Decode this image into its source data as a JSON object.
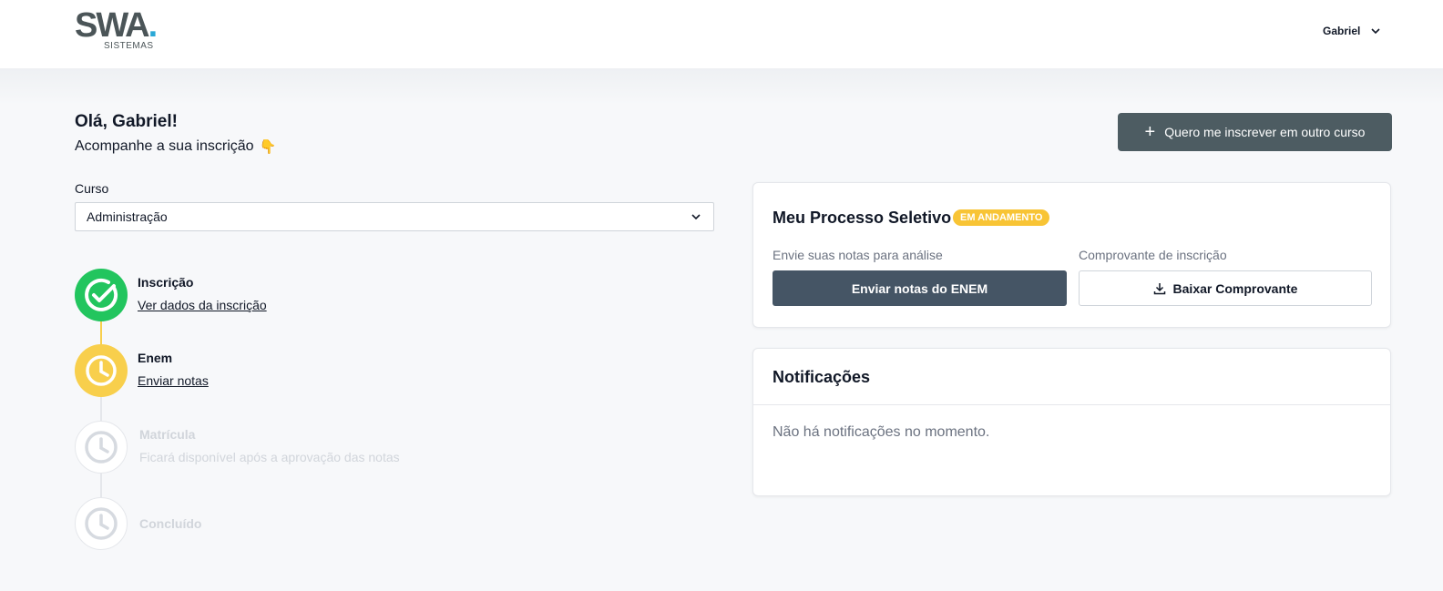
{
  "header": {
    "logo_main": "SWA",
    "logo_dot": ".",
    "logo_sub": "SISTEMAS",
    "user_name": "Gabriel"
  },
  "greeting": {
    "title": "Olá, Gabriel!",
    "subtitle": "Acompanhe a sua inscrição",
    "emoji": "👇"
  },
  "actions": {
    "new_course_label": "Quero me inscrever em outro curso"
  },
  "course": {
    "label": "Curso",
    "selected": "Administração"
  },
  "steps": [
    {
      "title": "Inscrição",
      "link": "Ver dados da inscrição",
      "status": "done"
    },
    {
      "title": "Enem",
      "link": "Enviar notas",
      "status": "current"
    },
    {
      "title": "Matrícula",
      "note": "Ficará disponível após a aprovação das notas",
      "status": "pending"
    },
    {
      "title": "Concluído",
      "status": "pending"
    }
  ],
  "process_card": {
    "title": "Meu Processo Seletivo",
    "badge": "EM ANDAMENTO",
    "send_label": "Envie suas notas para análise",
    "send_button": "Enviar notas do ENEM",
    "receipt_label": "Comprovante de inscrição",
    "receipt_button": "Baixar Comprovante"
  },
  "notifications": {
    "title": "Notificações",
    "empty": "Não há notificações no momento."
  },
  "colors": {
    "done": "#22c55e",
    "current": "#f8cf4c",
    "pending_border": "#e5e7eb",
    "primary_button": "#455565",
    "secondary_button": "#4d5c62",
    "badge": "#f8c435"
  }
}
